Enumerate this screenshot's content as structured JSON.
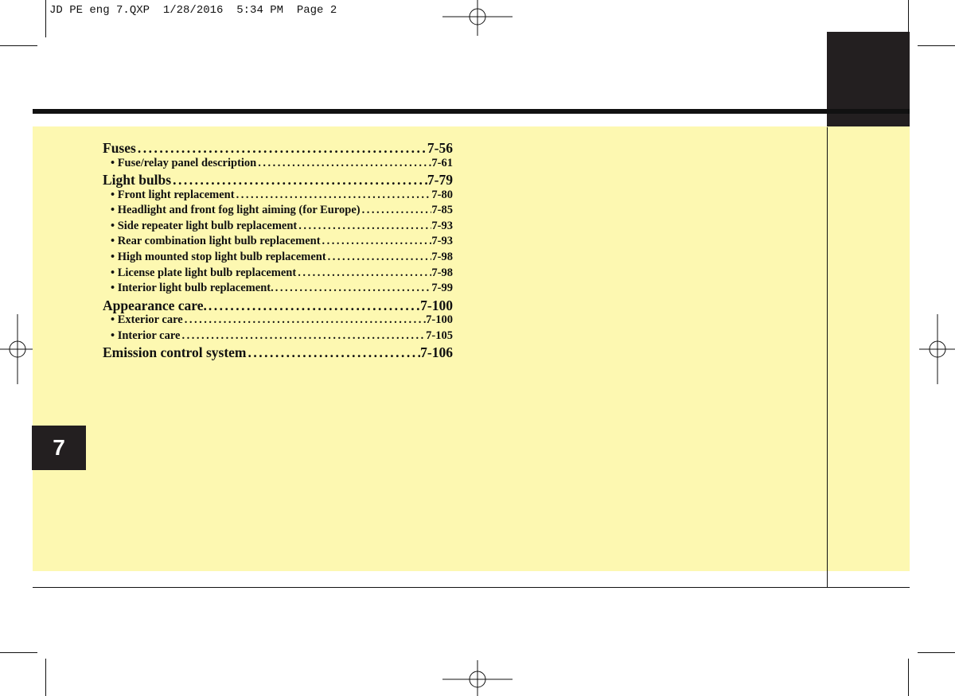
{
  "header": {
    "slug": "JD PE eng 7.QXP  1/28/2016  5:34 PM  Page 2"
  },
  "chapter": {
    "number": "7"
  },
  "toc": [
    {
      "level": "main",
      "label": "Fuses",
      "page": "7-56"
    },
    {
      "level": "sub",
      "label": "• Fuse/relay panel description",
      "page": "7-61"
    },
    {
      "level": "main",
      "label": "Light bulbs",
      "page": "7-79"
    },
    {
      "level": "sub",
      "label": "• Front light replacement",
      "page": "7-80"
    },
    {
      "level": "sub",
      "label": "• Headlight and front fog light aiming (for Europe)",
      "page": "7-85"
    },
    {
      "level": "sub",
      "label": "• Side repeater light bulb replacement",
      "page": "7-93"
    },
    {
      "level": "sub",
      "label": "• Rear combination light bulb replacement",
      "page": "7-93"
    },
    {
      "level": "sub",
      "label": "• High mounted stop light bulb replacement",
      "page": "7-98"
    },
    {
      "level": "sub",
      "label": "• License plate light bulb replacement",
      "page": "7-98"
    },
    {
      "level": "sub",
      "label": "• Interior light bulb replacement.",
      "page": "7-99"
    },
    {
      "level": "main",
      "label": "Appearance care.",
      "page": "7-100"
    },
    {
      "level": "sub",
      "label": "• Exterior care",
      "page": "7-100"
    },
    {
      "level": "sub",
      "label": "• Interior care",
      "page": "7-105"
    },
    {
      "level": "main",
      "label": "Emission control system",
      "page": "7-106"
    }
  ],
  "colors": {
    "panel_background": "#fdf8b1",
    "tab": "#231f20"
  }
}
